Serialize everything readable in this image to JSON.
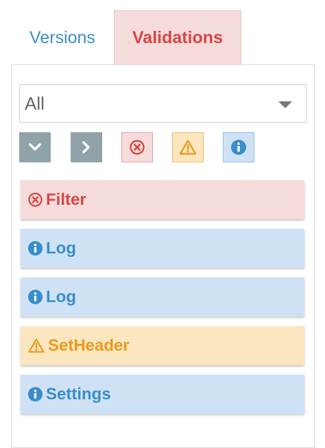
{
  "tabs": {
    "versions": "Versions",
    "validations": "Validations"
  },
  "filter_select": {
    "value": "All"
  },
  "filter_buttons": {
    "expand_icon": "chevron-down-icon",
    "collapse_icon": "chevron-right-icon",
    "error_icon": "error-circle-icon",
    "warning_icon": "warning-triangle-icon",
    "info_icon": "info-circle-icon"
  },
  "items": [
    {
      "label": "Filter",
      "level": "error"
    },
    {
      "label": "Log",
      "level": "info"
    },
    {
      "label": "Log",
      "level": "info"
    },
    {
      "label": "SetHeader",
      "level": "warning"
    },
    {
      "label": "Settings",
      "level": "info"
    }
  ],
  "colors": {
    "error": "#d54745",
    "warning": "#ea9b1f",
    "info": "#3a8dc8",
    "active_tab_bg": "#f6dbdb",
    "neutral_button": "#8fa3a9"
  }
}
